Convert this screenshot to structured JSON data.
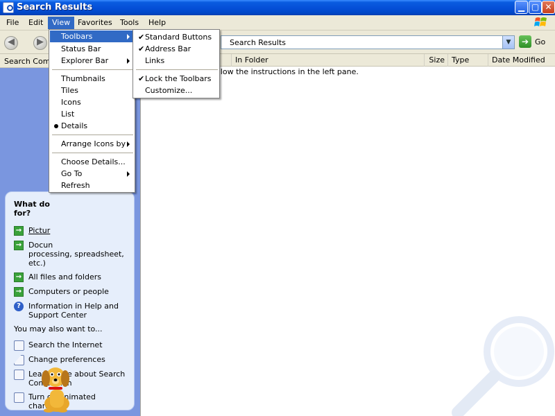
{
  "window": {
    "title": "Search Results"
  },
  "menubar": {
    "items": [
      {
        "label": "File"
      },
      {
        "label": "Edit"
      },
      {
        "label": "View"
      },
      {
        "label": "Favorites"
      },
      {
        "label": "Tools"
      },
      {
        "label": "Help"
      }
    ]
  },
  "address": {
    "value": "Search Results",
    "go_label": "Go"
  },
  "left_pane": {
    "title": "Search Comp",
    "question": "What do\nfor?",
    "options": [
      {
        "label": "Pictur"
      },
      {
        "label": "Docun\nprocessing, spreadsheet,\netc.)"
      },
      {
        "label": "All files and folders"
      },
      {
        "label": "Computers or people"
      },
      {
        "label": "Information in Help and\nSupport Center"
      }
    ],
    "also_label": "You may also want to...",
    "also_items": [
      {
        "label": "Search the Internet"
      },
      {
        "label": "Change preferences"
      },
      {
        "label": "Learn more about Search\nCompanion"
      },
      {
        "label": "Turn off animated character"
      }
    ]
  },
  "columns": [
    {
      "label": "In Folder"
    },
    {
      "label": "Size"
    },
    {
      "label": "Type"
    },
    {
      "label": "Date Modified"
    }
  ],
  "instruction": "ollow the instructions in the left pane.",
  "view_menu": {
    "items": [
      {
        "label": "Toolbars"
      },
      {
        "label": "Status Bar"
      },
      {
        "label": "Explorer Bar"
      },
      {
        "label": "Thumbnails"
      },
      {
        "label": "Tiles"
      },
      {
        "label": "Icons"
      },
      {
        "label": "List"
      },
      {
        "label": "Details"
      },
      {
        "label": "Arrange Icons by"
      },
      {
        "label": "Choose Details..."
      },
      {
        "label": "Go To"
      },
      {
        "label": "Refresh"
      }
    ]
  },
  "toolbars_menu": {
    "items": [
      {
        "label": "Standard Buttons"
      },
      {
        "label": "Address Bar"
      },
      {
        "label": "Links"
      },
      {
        "label": "Lock the Toolbars"
      },
      {
        "label": "Customize..."
      }
    ]
  },
  "colors": {
    "titlebar": "#0550D8",
    "menu_highlight": "#316AC5",
    "left_pane_bg": "#7A96DF",
    "bubble_bg": "#E6EEFB"
  }
}
